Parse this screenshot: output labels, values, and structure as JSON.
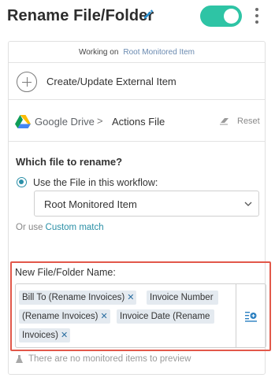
{
  "header": {
    "title": "Rename File/Folder",
    "toggle_on": true,
    "toggle_color": "#2ec4a5"
  },
  "working_on": {
    "label": "Working on",
    "value": "Root Monitored Item"
  },
  "create_item": {
    "label": "Create/Update External Item",
    "icon": "plus-circle-icon"
  },
  "service": {
    "name": "Google Drive",
    "separator": ">",
    "action": "Actions File",
    "reset_label": "Reset"
  },
  "question": {
    "label": "Which file to rename?",
    "radio_label": "Use the File in this workflow:",
    "radio_selected": true,
    "select_value": "Root Monitored Item",
    "or_use": "Or use",
    "custom_match": "Custom match"
  },
  "new_name": {
    "label": "New File/Folder Name:",
    "chips": [
      {
        "text": "Bill To (Rename Invoices)"
      },
      {
        "text": "Invoice Number"
      },
      {
        "text": "(Rename Invoices)"
      },
      {
        "text": "Invoice Date (Rename"
      },
      {
        "text": "Invoices)"
      }
    ],
    "highlight_color": "#e2584a"
  },
  "preview": {
    "text": "There are no monitored items to preview"
  },
  "colors": {
    "accent": "#2a8fa6",
    "chip_bg": "#e4eaf0"
  }
}
